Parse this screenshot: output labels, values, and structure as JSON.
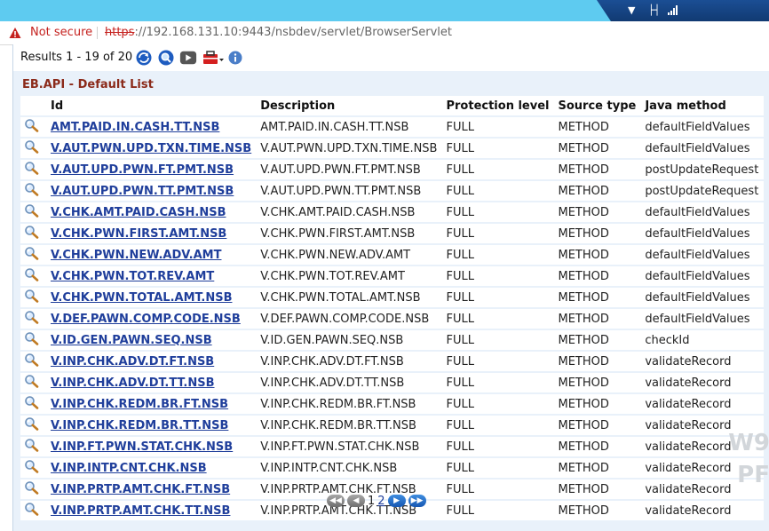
{
  "address_bar": {
    "security_label": "Not secure",
    "url_scheme": "https",
    "url_rest": "://192.168.131.10:9443/nsbdev/servlet/BrowserServlet"
  },
  "toolbar": {
    "results_label": "Results 1 - 19 of 20",
    "icons": [
      "refresh-icon",
      "find-icon",
      "forward-icon",
      "toolbox-icon",
      "info-icon"
    ]
  },
  "list": {
    "title": "EB.API - Default List",
    "columns": [
      "Id",
      "Description",
      "Protection level",
      "Source type",
      "Java method"
    ],
    "rows": [
      {
        "id": "AMT.PAID.IN.CASH.TT.NSB",
        "description": "AMT.PAID.IN.CASH.TT.NSB",
        "protection": "FULL",
        "source": "METHOD",
        "method": "defaultFieldValues"
      },
      {
        "id": "V.AUT.PWN.UPD.TXN.TIME.NSB",
        "description": "V.AUT.PWN.UPD.TXN.TIME.NSB",
        "protection": "FULL",
        "source": "METHOD",
        "method": "defaultFieldValues"
      },
      {
        "id": "V.AUT.UPD.PWN.FT.PMT.NSB",
        "description": "V.AUT.UPD.PWN.FT.PMT.NSB",
        "protection": "FULL",
        "source": "METHOD",
        "method": "postUpdateRequest"
      },
      {
        "id": "V.AUT.UPD.PWN.TT.PMT.NSB",
        "description": "V.AUT.UPD.PWN.TT.PMT.NSB",
        "protection": "FULL",
        "source": "METHOD",
        "method": "postUpdateRequest"
      },
      {
        "id": "V.CHK.AMT.PAID.CASH.NSB",
        "description": "V.CHK.AMT.PAID.CASH.NSB",
        "protection": "FULL",
        "source": "METHOD",
        "method": "defaultFieldValues"
      },
      {
        "id": "V.CHK.PWN.FIRST.AMT.NSB",
        "description": "V.CHK.PWN.FIRST.AMT.NSB",
        "protection": "FULL",
        "source": "METHOD",
        "method": "defaultFieldValues"
      },
      {
        "id": "V.CHK.PWN.NEW.ADV.AMT",
        "description": "V.CHK.PWN.NEW.ADV.AMT",
        "protection": "FULL",
        "source": "METHOD",
        "method": "defaultFieldValues"
      },
      {
        "id": "V.CHK.PWN.TOT.REV.AMT",
        "description": "V.CHK.PWN.TOT.REV.AMT",
        "protection": "FULL",
        "source": "METHOD",
        "method": "defaultFieldValues"
      },
      {
        "id": "V.CHK.PWN.TOTAL.AMT.NSB",
        "description": "V.CHK.PWN.TOTAL.AMT.NSB",
        "protection": "FULL",
        "source": "METHOD",
        "method": "defaultFieldValues"
      },
      {
        "id": "V.DEF.PAWN.COMP.CODE.NSB",
        "description": "V.DEF.PAWN.COMP.CODE.NSB",
        "protection": "FULL",
        "source": "METHOD",
        "method": "defaultFieldValues"
      },
      {
        "id": "V.ID.GEN.PAWN.SEQ.NSB",
        "description": "V.ID.GEN.PAWN.SEQ.NSB",
        "protection": "FULL",
        "source": "METHOD",
        "method": "checkId"
      },
      {
        "id": "V.INP.CHK.ADV.DT.FT.NSB",
        "description": "V.INP.CHK.ADV.DT.FT.NSB",
        "protection": "FULL",
        "source": "METHOD",
        "method": "validateRecord"
      },
      {
        "id": "V.INP.CHK.ADV.DT.TT.NSB",
        "description": "V.INP.CHK.ADV.DT.TT.NSB",
        "protection": "FULL",
        "source": "METHOD",
        "method": "validateRecord"
      },
      {
        "id": "V.INP.CHK.REDM.BR.FT.NSB",
        "description": "V.INP.CHK.REDM.BR.FT.NSB",
        "protection": "FULL",
        "source": "METHOD",
        "method": "validateRecord"
      },
      {
        "id": "V.INP.CHK.REDM.BR.TT.NSB",
        "description": "V.INP.CHK.REDM.BR.TT.NSB",
        "protection": "FULL",
        "source": "METHOD",
        "method": "validateRecord"
      },
      {
        "id": "V.INP.FT.PWN.STAT.CHK.NSB",
        "description": "V.INP.FT.PWN.STAT.CHK.NSB",
        "protection": "FULL",
        "source": "METHOD",
        "method": "validateRecord"
      },
      {
        "id": "V.INP.INTP.CNT.CHK.NSB",
        "description": "V.INP.INTP.CNT.CHK.NSB",
        "protection": "FULL",
        "source": "METHOD",
        "method": "validateRecord"
      },
      {
        "id": "V.INP.PRTP.AMT.CHK.FT.NSB",
        "description": "V.INP.PRTP.AMT.CHK.FT.NSB",
        "protection": "FULL",
        "source": "METHOD",
        "method": "validateRecord"
      },
      {
        "id": "V.INP.PRTP.AMT.CHK.TT.NSB",
        "description": "V.INP.PRTP.AMT.CHK.TT.NSB",
        "protection": "FULL",
        "source": "METHOD",
        "method": "validateRecord"
      }
    ]
  },
  "pager": {
    "pages": [
      "1",
      "2"
    ],
    "current_page": "1"
  },
  "watermark": [
    "W9",
    "PF"
  ],
  "colors": {
    "title_bar": "#5ecbf0",
    "content_bg": "#e9f1fa",
    "link": "#1f3e9b",
    "list_title": "#8b2a1a",
    "not_secure": "#c5221f"
  }
}
